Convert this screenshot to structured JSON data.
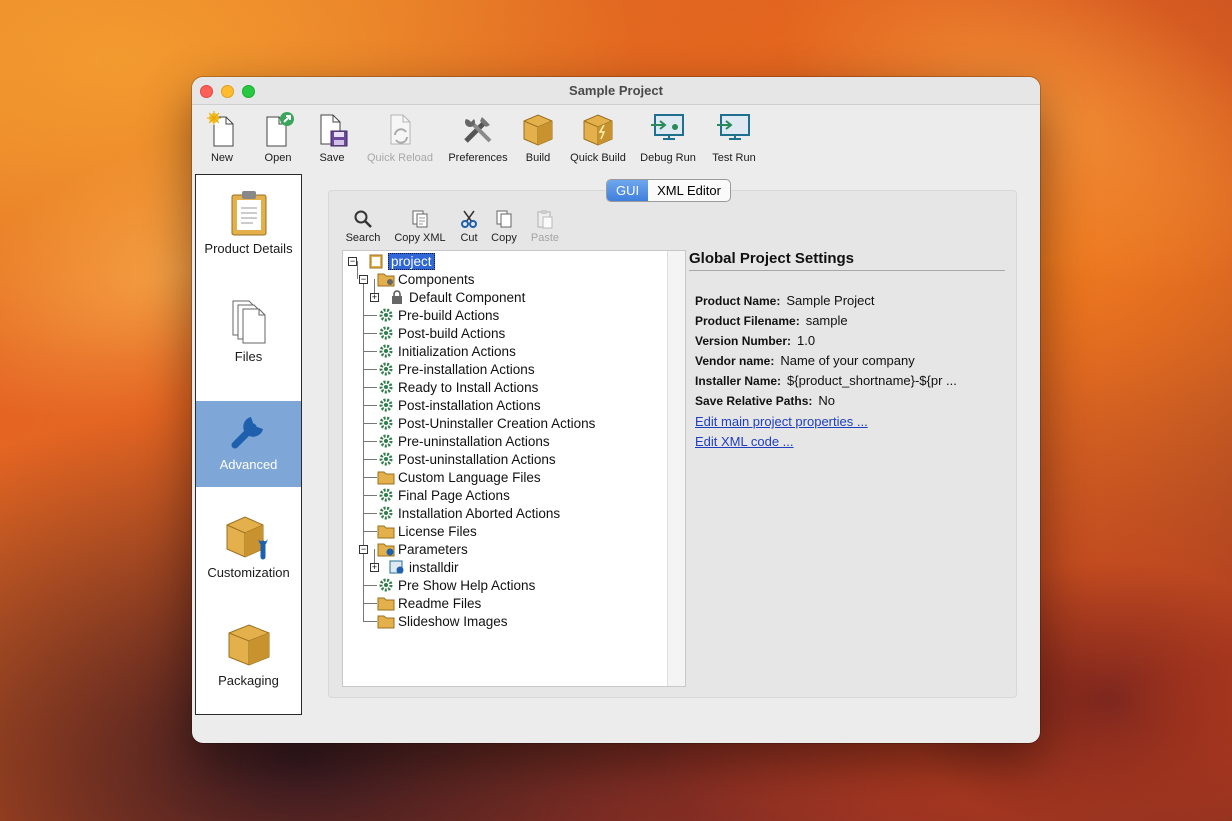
{
  "window": {
    "title": "Sample Project"
  },
  "toolbar": {
    "items": [
      {
        "label": "New",
        "icon": "new-file-icon",
        "enabled": true
      },
      {
        "label": "Open",
        "icon": "open-file-icon",
        "enabled": true
      },
      {
        "label": "Save",
        "icon": "save-icon",
        "enabled": true
      },
      {
        "label": "Quick Reload",
        "icon": "reload-icon",
        "enabled": false
      },
      {
        "label": "Preferences",
        "icon": "tools-icon",
        "enabled": true
      },
      {
        "label": "Build",
        "icon": "box-icon",
        "enabled": true
      },
      {
        "label": "Quick Build",
        "icon": "box-lightning-icon",
        "enabled": true
      },
      {
        "label": "Debug Run",
        "icon": "debug-monitor-icon",
        "enabled": true
      },
      {
        "label": "Test Run",
        "icon": "run-monitor-icon",
        "enabled": true
      }
    ]
  },
  "sidebar": {
    "items": [
      {
        "label": "Product Details",
        "icon": "clipboard-icon",
        "active": false
      },
      {
        "label": "Files",
        "icon": "files-icon",
        "active": false
      },
      {
        "label": "Advanced",
        "icon": "wrench-icon",
        "active": true
      },
      {
        "label": "Customization",
        "icon": "box-wrench-icon",
        "active": false
      },
      {
        "label": "Packaging",
        "icon": "package-icon",
        "active": false
      }
    ]
  },
  "view_toggle": {
    "options": [
      "GUI",
      "XML Editor"
    ],
    "selected": "GUI"
  },
  "sub_toolbar": {
    "items": [
      {
        "label": "Search",
        "icon": "search-icon",
        "enabled": true
      },
      {
        "label": "Copy XML",
        "icon": "copy-xml-icon",
        "enabled": true
      },
      {
        "label": "Cut",
        "icon": "scissors-icon",
        "enabled": true
      },
      {
        "label": "Copy",
        "icon": "copy-icon",
        "enabled": true
      },
      {
        "label": "Paste",
        "icon": "paste-icon",
        "enabled": false
      }
    ]
  },
  "tree": {
    "root": "project",
    "nodes": [
      "Components",
      "Default Component",
      "Pre-build Actions",
      "Post-build Actions",
      "Initialization Actions",
      "Pre-installation Actions",
      "Ready to Install Actions",
      "Post-installation Actions",
      "Post-Uninstaller Creation Actions",
      "Pre-uninstallation Actions",
      "Post-uninstallation Actions",
      "Custom Language Files",
      "Final Page Actions",
      "Installation Aborted Actions",
      "License Files",
      "Parameters",
      "installdir",
      "Pre Show Help Actions",
      "Readme Files",
      "Slideshow Images"
    ]
  },
  "settings": {
    "title": "Global Project Settings",
    "properties": [
      {
        "label": "Product Name:",
        "value": "Sample Project"
      },
      {
        "label": "Product Filename:",
        "value": "sample"
      },
      {
        "label": "Version Number:",
        "value": "1.0"
      },
      {
        "label": "Vendor name:",
        "value": "Name of your company"
      },
      {
        "label": "Installer Name:",
        "value": "${product_shortname}-${pr ..."
      },
      {
        "label": "Save Relative Paths:",
        "value": "No"
      }
    ],
    "links": [
      "Edit main project properties ...",
      "Edit XML code ..."
    ]
  }
}
